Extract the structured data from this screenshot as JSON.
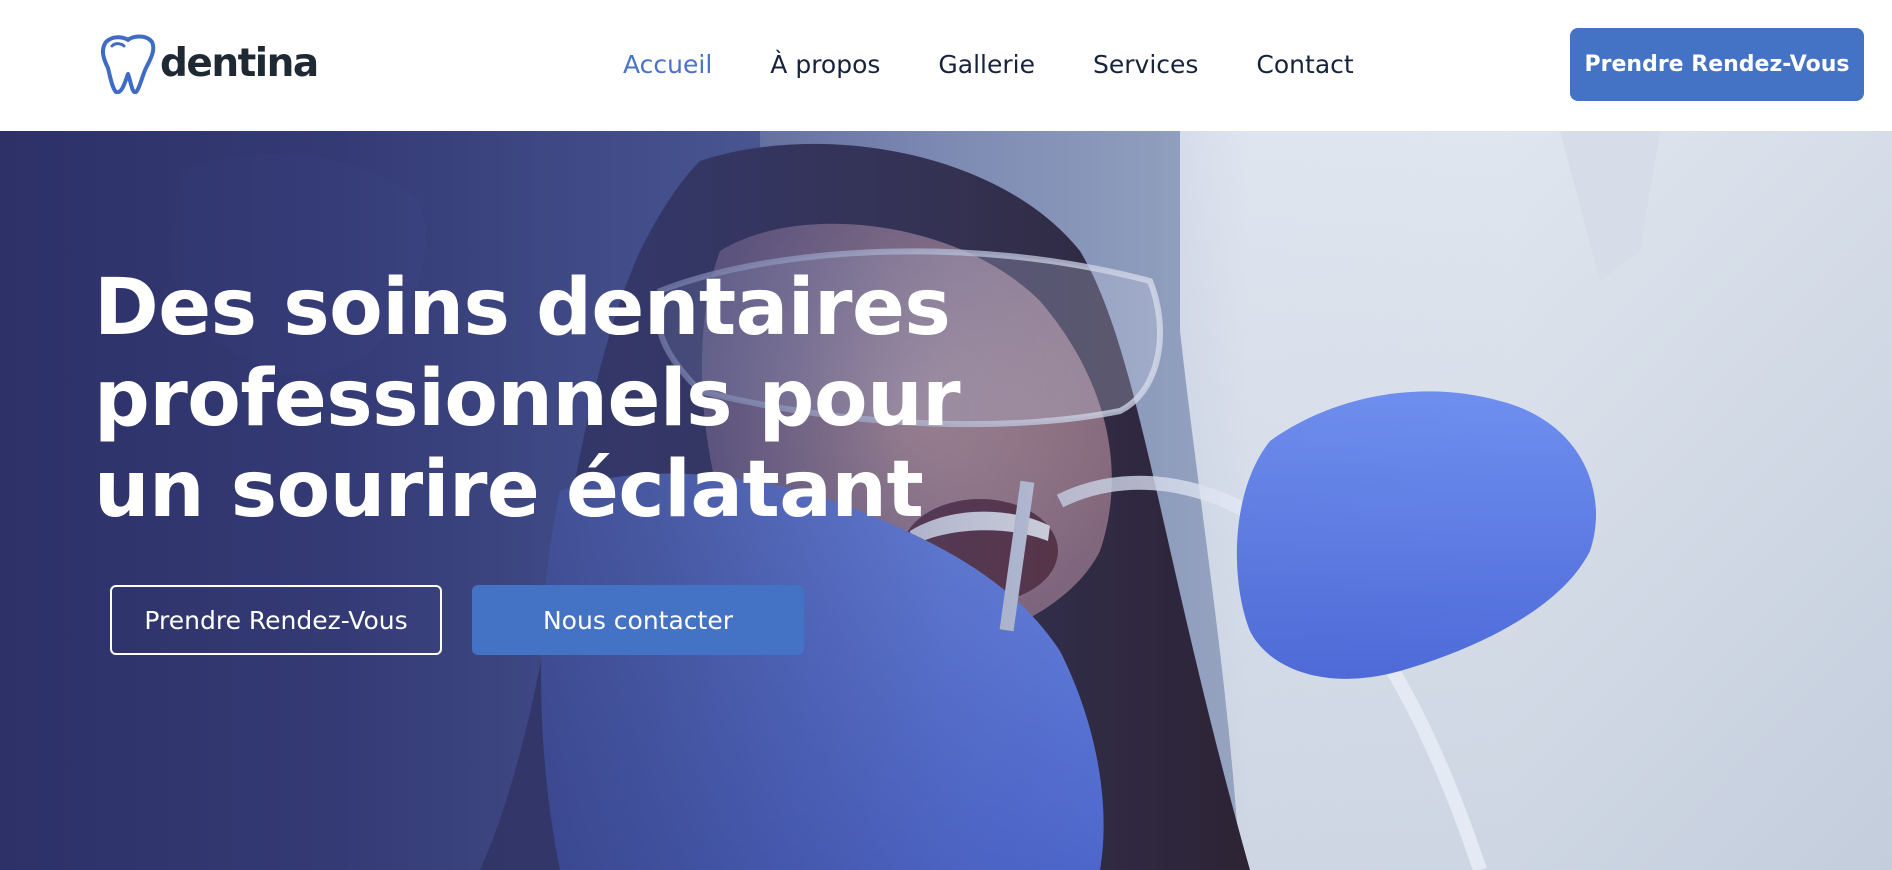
{
  "brand": {
    "name": "dentina",
    "icon": "tooth-icon",
    "logo_color": "#3f6bc4"
  },
  "nav": {
    "items": [
      {
        "label": "Accueil",
        "active": true
      },
      {
        "label": "À propos",
        "active": false
      },
      {
        "label": "Gallerie",
        "active": false
      },
      {
        "label": "Services",
        "active": false
      },
      {
        "label": "Contact",
        "active": false
      }
    ],
    "active_color": "#4a73c8",
    "text_color": "#17233d"
  },
  "header_cta": {
    "label": "Prendre Rendez-Vous"
  },
  "hero": {
    "title": "Des soins dentaires professionnels pour un sourire éclatant",
    "buttons": {
      "primary_outline": "Prendre Rendez-Vous",
      "secondary_solid": "Nous contacter"
    },
    "image": "dentist-treating-patient-photo",
    "overlay_color": "#2c2f66"
  },
  "colors": {
    "accent": "#4472c4",
    "white": "#ffffff"
  }
}
